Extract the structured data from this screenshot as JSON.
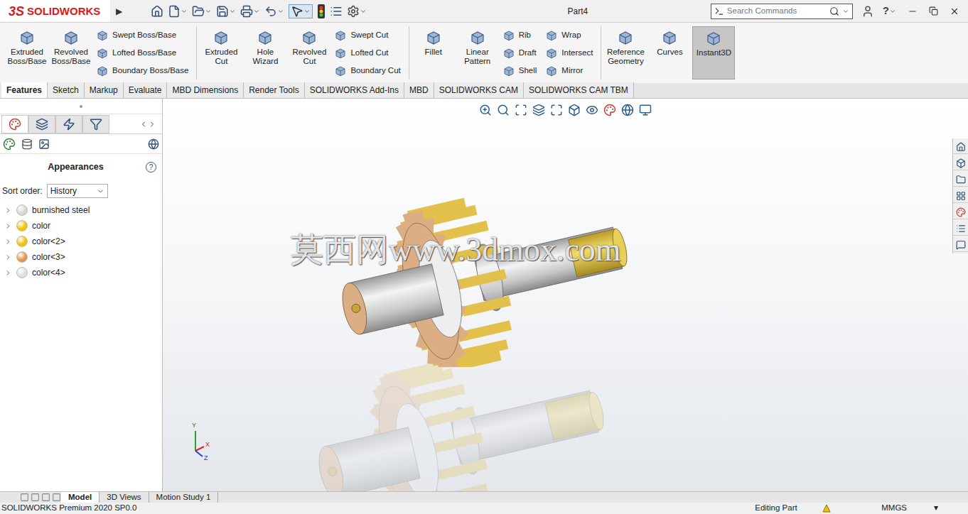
{
  "title_bar": {
    "logo_mark": "3S",
    "logo_text": "SOLIDWORKS",
    "expand": "▶",
    "document": "Part4",
    "search_placeholder": "Search Commands",
    "help": "?"
  },
  "ribbon": [
    {
      "items": [
        {
          "label": "Extruded Boss/Base",
          "kind": "large",
          "selected": false
        },
        {
          "label": "Revolved Boss/Base",
          "kind": "large",
          "selected": false
        },
        {
          "label": "Swept Boss/Base",
          "kind": "small",
          "selected": false
        },
        {
          "label": "Lofted Boss/Base",
          "kind": "small",
          "selected": false
        },
        {
          "label": "Boundary Boss/Base",
          "kind": "small",
          "selected": false
        }
      ]
    },
    {
      "items": [
        {
          "label": "Extruded Cut",
          "kind": "large",
          "selected": false
        },
        {
          "label": "Hole Wizard",
          "kind": "large",
          "selected": false
        },
        {
          "label": "Revolved Cut",
          "kind": "large",
          "selected": false
        },
        {
          "label": "Swept Cut",
          "kind": "small",
          "selected": false
        },
        {
          "label": "Lofted Cut",
          "kind": "small",
          "selected": false
        },
        {
          "label": "Boundary Cut",
          "kind": "small",
          "selected": false
        }
      ]
    },
    {
      "items": [
        {
          "label": "Fillet",
          "kind": "large",
          "selected": false
        },
        {
          "label": "Linear Pattern",
          "kind": "large",
          "selected": false
        },
        {
          "label": "Rib",
          "kind": "small",
          "selected": false
        },
        {
          "label": "Draft",
          "kind": "small",
          "selected": false
        },
        {
          "label": "Shell",
          "kind": "small",
          "selected": false
        },
        {
          "label": "Wrap",
          "kind": "small",
          "selected": false
        },
        {
          "label": "Intersect",
          "kind": "small",
          "selected": false
        },
        {
          "label": "Mirror",
          "kind": "small",
          "selected": false
        }
      ]
    },
    {
      "items": [
        {
          "label": "Reference Geometry",
          "kind": "large",
          "selected": false
        },
        {
          "label": "Curves",
          "kind": "large",
          "selected": false
        },
        {
          "label": "Instant3D",
          "kind": "large",
          "selected": true
        }
      ]
    }
  ],
  "command_tabs": [
    {
      "label": "Features",
      "selected": true
    },
    {
      "label": "Sketch",
      "selected": false
    },
    {
      "label": "Markup",
      "selected": false
    },
    {
      "label": "Evaluate",
      "selected": false
    },
    {
      "label": "MBD Dimensions",
      "selected": false
    },
    {
      "label": "Render Tools",
      "selected": false
    },
    {
      "label": "SOLIDWORKS Add-Ins",
      "selected": false
    },
    {
      "label": "MBD",
      "selected": false
    },
    {
      "label": "SOLIDWORKS CAM",
      "selected": false
    },
    {
      "label": "SOLIDWORKS CAM TBM",
      "selected": false
    }
  ],
  "appearances": {
    "title": "Appearances",
    "help": "?",
    "sort_label": "Sort order:",
    "sort_value": "History",
    "items": [
      {
        "name": "burnished steel",
        "color": "#d9d6d0"
      },
      {
        "name": "color",
        "color": "#f2c200"
      },
      {
        "name": "color<2>",
        "color": "#f2c200"
      },
      {
        "name": "color<3>",
        "color": "#e0964f"
      },
      {
        "name": "color<4>",
        "color": "#dedede"
      }
    ]
  },
  "watermark": "莫西网www.3dmox.com",
  "triad": {
    "y": "Y",
    "x": "X",
    "z": "Z"
  },
  "model_tabs": [
    {
      "label": "Model",
      "selected": true
    },
    {
      "label": "3D Views",
      "selected": false
    },
    {
      "label": "Motion Study 1",
      "selected": false
    }
  ],
  "status_bar": {
    "product": "SOLIDWORKS Premium 2020 SP0.0",
    "mode": "Editing Part",
    "units": "MMGS",
    "units_arrow": "▾"
  }
}
